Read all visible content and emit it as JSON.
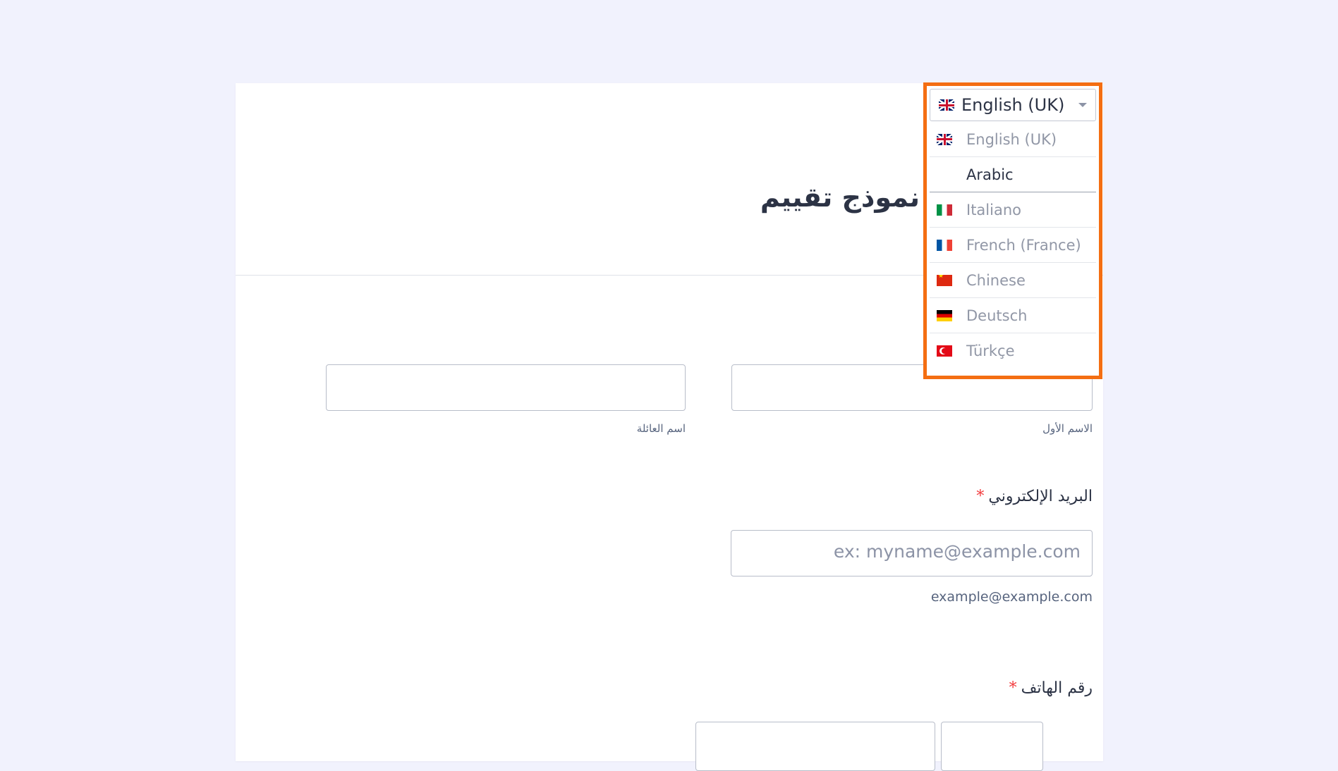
{
  "form": {
    "title": "نموذج تقييم",
    "name_field": {
      "first_name_sublabel": "الاسم الأول",
      "last_name_sublabel": "اسم العائلة"
    },
    "email_field": {
      "label": "البريد الإلكتروني",
      "required_mark": "*",
      "placeholder": "ex: myname@example.com",
      "helper": "example@example.com"
    },
    "phone_field": {
      "label": "رقم الهاتف",
      "required_mark": "*"
    }
  },
  "language_selector": {
    "selected": "English (UK)",
    "selected_flag": "uk-flag-icon",
    "options": [
      {
        "label": "English (UK)",
        "flag": "uk-flag-icon"
      },
      {
        "label": "Arabic",
        "flag": ""
      },
      {
        "label": "Italiano",
        "flag": "italy-flag-icon"
      },
      {
        "label": "French (France)",
        "flag": "france-flag-icon"
      },
      {
        "label": "Chinese",
        "flag": "china-flag-icon"
      },
      {
        "label": "Deutsch",
        "flag": "germany-flag-icon"
      },
      {
        "label": "Türkçe",
        "flag": "turkey-flag-icon"
      }
    ],
    "hovered": "Arabic",
    "highlight_color": "#f46e12"
  }
}
